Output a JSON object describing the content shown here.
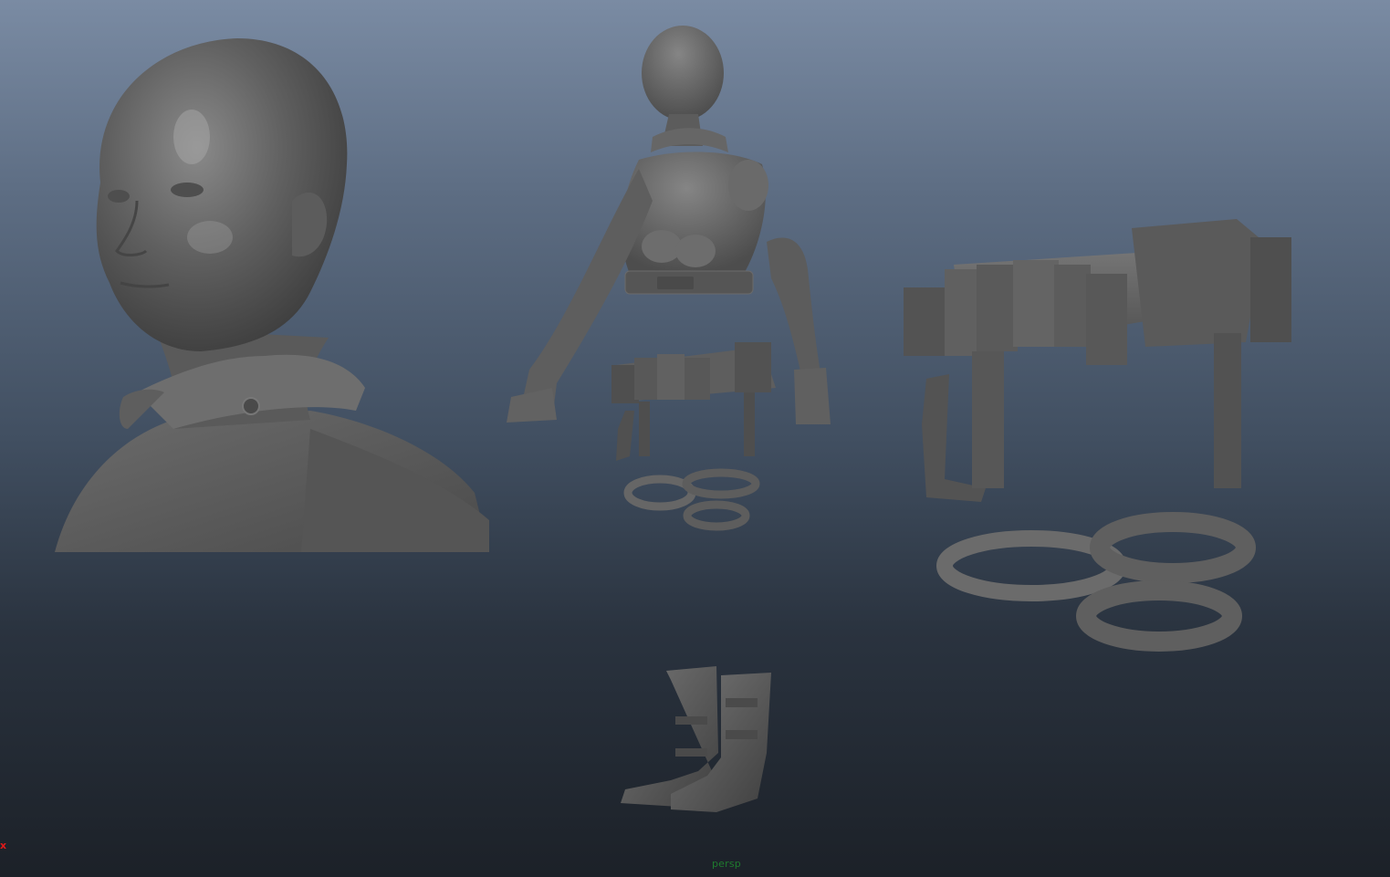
{
  "viewport": {
    "camera": "persp",
    "axis_label": "x",
    "axis_color": "#e01a1a",
    "camera_label_color": "#1f7a2e",
    "background_top": "#7a8ba3",
    "background_bottom": "#1c2128"
  },
  "models": [
    {
      "name": "head-bust-closeup"
    },
    {
      "name": "full-torso-with-arms"
    },
    {
      "name": "utility-belt-small"
    },
    {
      "name": "leg-straps-small"
    },
    {
      "name": "boots"
    },
    {
      "name": "utility-belt-large"
    },
    {
      "name": "leg-straps-large"
    }
  ]
}
